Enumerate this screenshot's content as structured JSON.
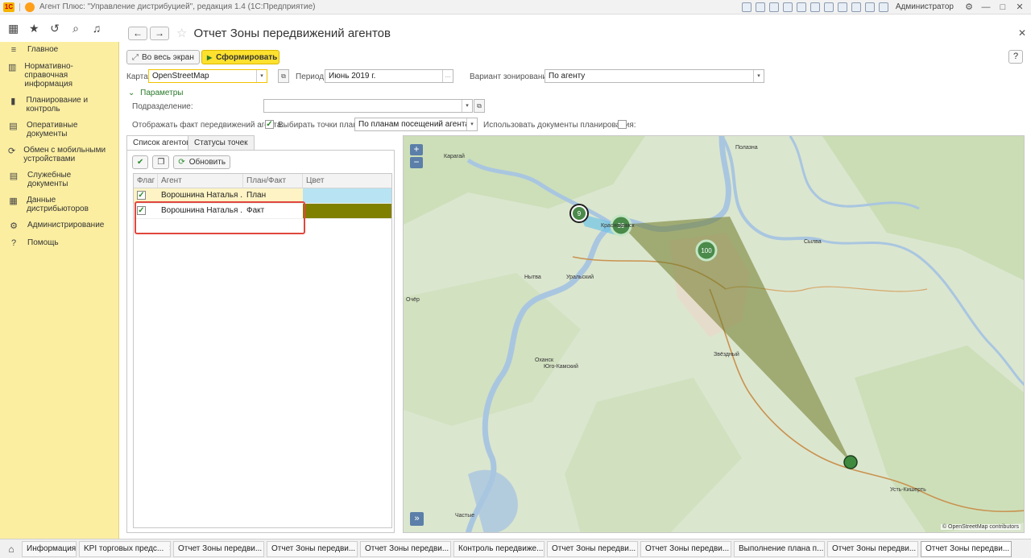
{
  "app": {
    "title": "Агент Плюс: \"Управление дистрибуцией\", редакция 1.4 (1С:Предприятие)",
    "logo": "1С",
    "user": "Администратор"
  },
  "sidebar": {
    "items": [
      {
        "icon": "menu-icon",
        "label": "Главное"
      },
      {
        "icon": "book-icon",
        "label": "Нормативно-справочная информация"
      },
      {
        "icon": "chart-icon",
        "label": "Планирование и контроль"
      },
      {
        "icon": "docs-icon",
        "label": "Оперативные документы"
      },
      {
        "icon": "sync-icon",
        "label": "Обмен с мобильными устройствами"
      },
      {
        "icon": "list-icon",
        "label": "Служебные документы"
      },
      {
        "icon": "table-icon",
        "label": "Данные дистрибьюторов"
      },
      {
        "icon": "gear-icon",
        "label": "Администрирование"
      },
      {
        "icon": "help-icon",
        "label": "Помощь"
      }
    ]
  },
  "header": {
    "title": "Отчет Зоны передвижений агентов",
    "fullscreen_label": "Во весь экран",
    "generate_label": "Сформировать",
    "help_label": "?"
  },
  "form": {
    "map_label": "Карта:",
    "map_value": "OpenStreetMap",
    "period_label": "Период:",
    "period_value": "Июнь 2019 г.",
    "zoning_label": "Вариант зонирования:",
    "zoning_value": "По агенту",
    "params_label": "Параметры",
    "division_label": "Подразделение:",
    "division_value": "",
    "show_fact_label": "Отображать факт передвижений агента:",
    "show_fact_checked": true,
    "plan_points_label": "Выбирать точки плана:",
    "plan_points_value": "По планам посещений агента",
    "use_docs_label": "Использовать документы планирования:",
    "use_docs_checked": false
  },
  "tabs": [
    {
      "label": "Список агентов",
      "active": true
    },
    {
      "label": "Статусы точек",
      "active": false
    }
  ],
  "toolbar": {
    "refresh_label": "Обновить"
  },
  "table": {
    "columns": [
      "Флаг",
      "Агент",
      "План/Факт",
      "Цвет"
    ],
    "rows": [
      {
        "checked": true,
        "agent": "Ворошнина Наталья ...",
        "plan_fact": "План",
        "color": "#b7e3f3"
      },
      {
        "checked": true,
        "agent": "Ворошнина Наталья ...",
        "plan_fact": "Факт",
        "color": "#808000"
      }
    ]
  },
  "map": {
    "zoom_in": "+",
    "zoom_out": "−",
    "expand": "»",
    "attribution": "© OpenStreetMap contributors",
    "labels": [
      "Карагай",
      "Полазна",
      "Краснокамск",
      "Нытва",
      "Уральский",
      "Сылва",
      "Очёр",
      "Оханск",
      "Юго-Камский",
      "Звёздный",
      "Усть-Кишерть",
      "Частые"
    ],
    "markers": [
      {
        "label": "9"
      },
      {
        "label": "39"
      },
      {
        "label": "100"
      }
    ]
  },
  "taskbar": {
    "tabs": [
      {
        "label": "Информация",
        "active": false
      },
      {
        "label": "KPI торговых предс...",
        "active": false
      },
      {
        "label": "Отчет Зоны передви...",
        "active": false
      },
      {
        "label": "Отчет Зоны передви...",
        "active": false
      },
      {
        "label": "Отчет Зоны передви...",
        "active": false
      },
      {
        "label": "Контроль передвиже...",
        "active": false
      },
      {
        "label": "Отчет Зоны передви...",
        "active": false
      },
      {
        "label": "Отчет Зоны передви...",
        "active": false
      },
      {
        "label": "Выполнение плана п...",
        "active": false
      },
      {
        "label": "Отчет Зоны передви...",
        "active": false
      },
      {
        "label": "Отчет Зоны передви...",
        "active": true
      }
    ]
  }
}
